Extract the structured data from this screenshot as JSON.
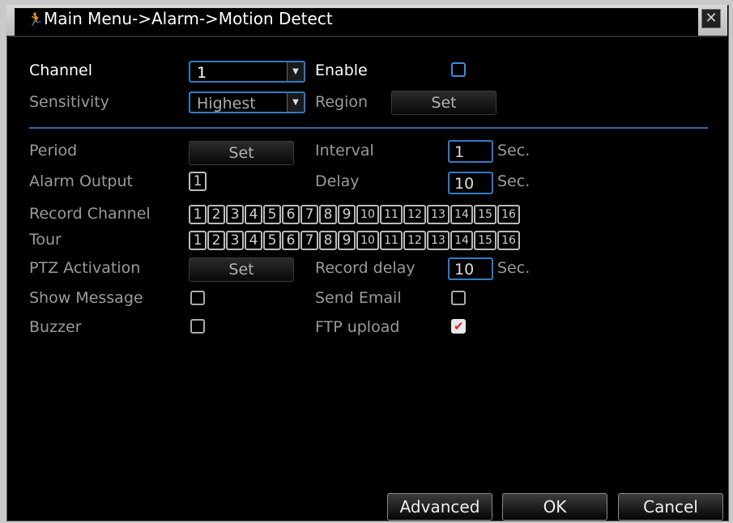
{
  "title": "Main Menu->Alarm->Motion Detect",
  "icons": {
    "title": "person-running-icon",
    "close": "close-icon"
  },
  "labels": {
    "channel": "Channel",
    "enable": "Enable",
    "sensitivity": "Sensitivity",
    "region": "Region",
    "period": "Period",
    "interval": "Interval",
    "alarm_output": "Alarm Output",
    "delay": "Delay",
    "record_channel": "Record Channel",
    "tour": "Tour",
    "ptz_activation": "PTZ Activation",
    "record_delay": "Record delay",
    "show_message": "Show Message",
    "send_email": "Send Email",
    "buzzer": "Buzzer",
    "ftp_upload": "FTP upload"
  },
  "values": {
    "channel": "1",
    "sensitivity": "Highest",
    "interval": "1",
    "delay": "10",
    "record_delay": "10",
    "alarm_output": "1"
  },
  "units": {
    "sec": "Sec."
  },
  "buttons": {
    "set": "Set",
    "advanced": "Advanced",
    "ok": "OK",
    "cancel": "Cancel"
  },
  "checkboxes": {
    "enable": false,
    "show_message": false,
    "send_email": false,
    "buzzer": false,
    "ftp_upload": true
  },
  "channels": [
    "1",
    "2",
    "3",
    "4",
    "5",
    "6",
    "7",
    "8",
    "9",
    "10",
    "11",
    "12",
    "13",
    "14",
    "15",
    "16"
  ],
  "colors": {
    "accent": "#2f7cc7",
    "background": "#000000",
    "check": "#e02020"
  }
}
